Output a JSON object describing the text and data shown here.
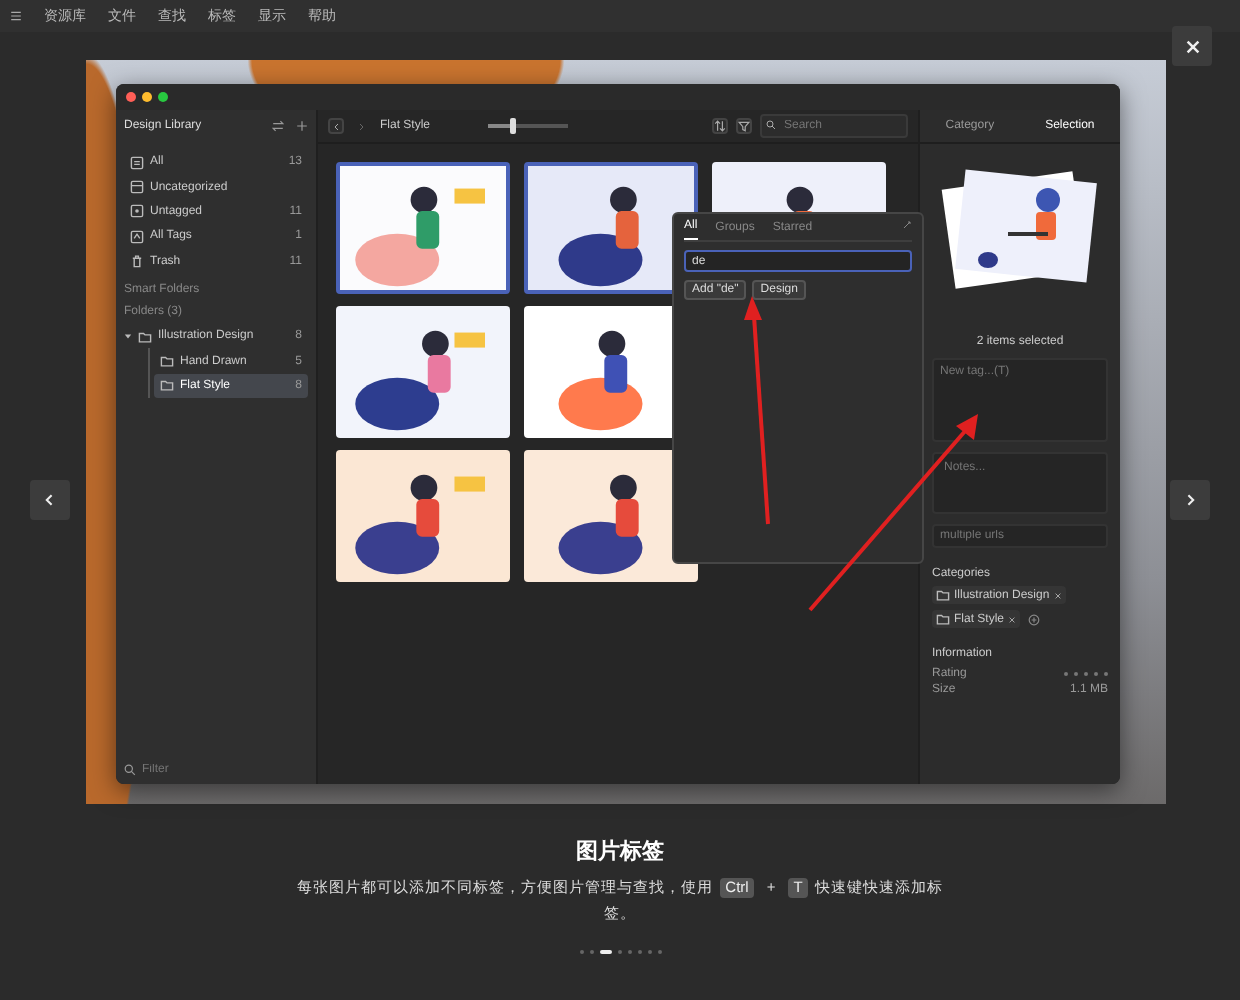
{
  "menu_bar": {
    "items": [
      "资源库",
      "文件",
      "查找",
      "标签",
      "显示",
      "帮助"
    ]
  },
  "app_window": {
    "sidebar": {
      "library": "Design Library",
      "items": [
        {
          "label": "All",
          "count": "13",
          "selected": false
        },
        {
          "label": "Uncategorized",
          "selected": false
        },
        {
          "label": "Untagged",
          "count": "11",
          "selected": false
        },
        {
          "label": "All Tags",
          "count": "1",
          "selected": false
        },
        {
          "label": "Trash",
          "count": "11",
          "selected": false
        }
      ],
      "smart_folders_heading": "Smart Folders",
      "folders_heading": "Folders (3)",
      "folders": [
        {
          "label": "Illustration Design",
          "count": "8",
          "expanded": true,
          "selected": false,
          "children": [
            {
              "label": "Hand Drawn",
              "count": "5",
              "selected": false
            },
            {
              "label": "Flat Style",
              "count": "8",
              "selected": true
            }
          ]
        }
      ],
      "filter": {
        "placeholder": "Filter"
      }
    },
    "toolbar": {
      "title": "Flat Style",
      "zoom": {
        "level": 0.3
      },
      "search": {
        "placeholder": "Search"
      }
    },
    "thumbnail_rows": [
      [
        {
          "selected": true
        },
        {
          "selected": true
        },
        {
          "selected": false
        }
      ],
      [
        {
          "selected": false
        },
        {
          "selected": false
        }
      ],
      [
        {
          "selected": false
        },
        {
          "selected": false
        }
      ]
    ],
    "tag_popup": {
      "tabs": [
        {
          "label": "All",
          "selected": true
        },
        {
          "label": "Groups",
          "selected": false
        },
        {
          "label": "Starred",
          "selected": false
        }
      ],
      "input": {
        "value": "de"
      },
      "suggestions": [
        "Add \"de\"",
        "Design"
      ]
    },
    "inspector": {
      "tabs": [
        {
          "label": "Category",
          "selected": false
        },
        {
          "label": "Selection",
          "selected": true
        }
      ],
      "selection_summary": "2 items selected",
      "tag_field": {
        "placeholder": "New tag...(T)"
      },
      "notes_field": {
        "placeholder": "Notes..."
      },
      "url_field": {
        "placeholder": "multiple urls"
      },
      "categories_heading": "Categories",
      "categories": [
        "Illustration Design",
        "Flat Style"
      ],
      "information_heading": "Information",
      "info": [
        {
          "label": "Rating",
          "kind": "stars",
          "stars": 0
        },
        {
          "label": "Size",
          "kind": "text",
          "value": "1.1 MB"
        }
      ]
    }
  },
  "caption": {
    "title": "图片标签",
    "parts": [
      {
        "kind": "text",
        "text": "每张图片都可以添加不同标签，方便图片管理与查找，使用"
      },
      {
        "kind": "key",
        "text": "Ctrl"
      },
      {
        "kind": "text",
        "text": "+"
      },
      {
        "kind": "key",
        "text": "T"
      },
      {
        "kind": "text",
        "text": "快速键快速添加标签。"
      }
    ]
  },
  "pager": [
    {
      "selected": false
    },
    {
      "selected": false
    },
    {
      "selected": true
    },
    {
      "selected": false
    },
    {
      "selected": false
    },
    {
      "selected": false
    },
    {
      "selected": false
    },
    {
      "selected": false
    }
  ]
}
